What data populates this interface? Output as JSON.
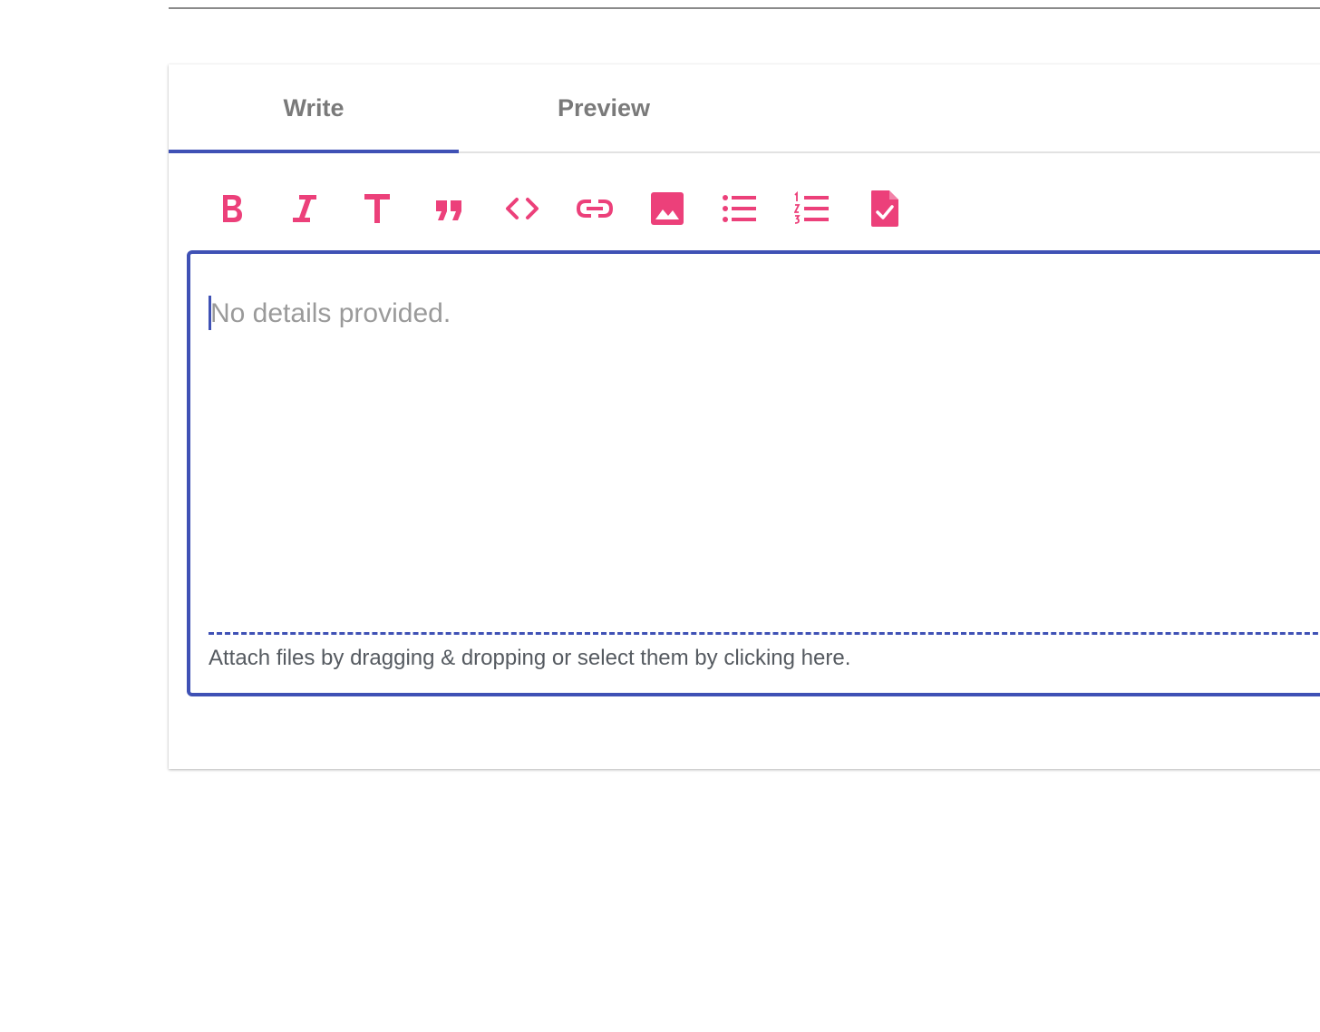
{
  "tabs": [
    {
      "label": "Write",
      "active": true
    },
    {
      "label": "Preview",
      "active": false
    }
  ],
  "toolbar": {
    "icon_color": "#ec407a",
    "buttons": [
      {
        "name": "bold-icon"
      },
      {
        "name": "italic-icon"
      },
      {
        "name": "header-icon"
      },
      {
        "name": "quote-icon"
      },
      {
        "name": "code-icon"
      },
      {
        "name": "link-icon"
      },
      {
        "name": "image-icon"
      },
      {
        "name": "bulleted-list-icon"
      },
      {
        "name": "numbered-list-icon"
      },
      {
        "name": "task-list-icon"
      }
    ]
  },
  "editor": {
    "placeholder": "No details provided.",
    "attach_hint": "Attach files by dragging & dropping or select them by clicking here."
  },
  "colors": {
    "accent": "#3f51b5",
    "icon": "#ec407a",
    "tab_text": "#7a7a7a"
  }
}
